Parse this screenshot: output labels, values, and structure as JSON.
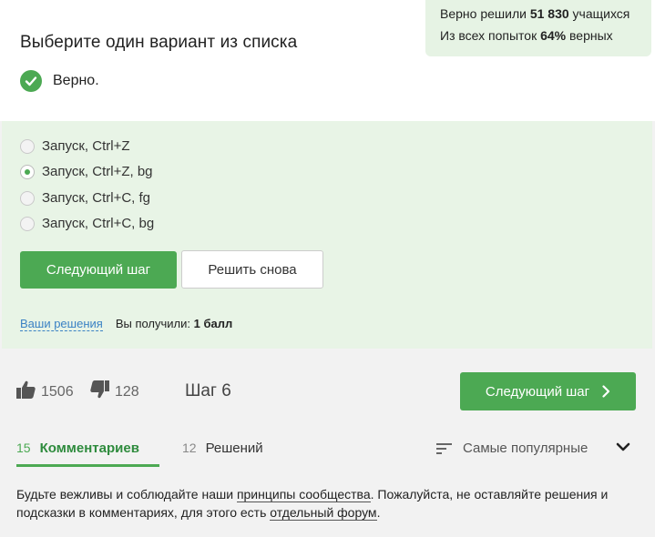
{
  "stats": {
    "line1_prefix": "Верно решили",
    "line1_count": "51 830",
    "line1_suffix": "учащихся",
    "line2_prefix": "Из всех попыток",
    "line2_percent": "64%",
    "line2_suffix": "верных"
  },
  "question": {
    "title": "Выберите один вариант из списка",
    "verdict": "Верно."
  },
  "options": [
    {
      "label": "Запуск, Ctrl+Z",
      "selected": false
    },
    {
      "label": "Запуск, Ctrl+Z, bg",
      "selected": true
    },
    {
      "label": "Запуск, Ctrl+C, fg",
      "selected": false
    },
    {
      "label": "Запуск, Ctrl+C, bg",
      "selected": false
    }
  ],
  "actions": {
    "next_step": "Следующий шаг",
    "solve_again": "Решить снова"
  },
  "result": {
    "solutions_link": "Ваши решения",
    "score_prefix": "Вы получили:",
    "score_value": "1 балл"
  },
  "footer": {
    "likes": "1506",
    "dislikes": "128",
    "step": "Шаг 6",
    "next_step": "Следующий шаг"
  },
  "tabs": [
    {
      "count": "15",
      "label": "Комментариев",
      "active": true
    },
    {
      "count": "12",
      "label": "Решений",
      "active": false
    }
  ],
  "sort": {
    "label": "Самые популярные"
  },
  "community": {
    "part1": "Будьте вежливы и соблюдайте наши ",
    "link1": "принципы сообщества",
    "part2": ". Пожалуйста, не оставляйте решения и подсказки в комментариях, для этого есть ",
    "link2": "отдельный форум",
    "part3": "."
  },
  "colors": {
    "accent": "#4ca953",
    "correct_bg": "#e8f4e6",
    "stats_bg": "#e6f3e4",
    "link": "#3b82c4"
  }
}
